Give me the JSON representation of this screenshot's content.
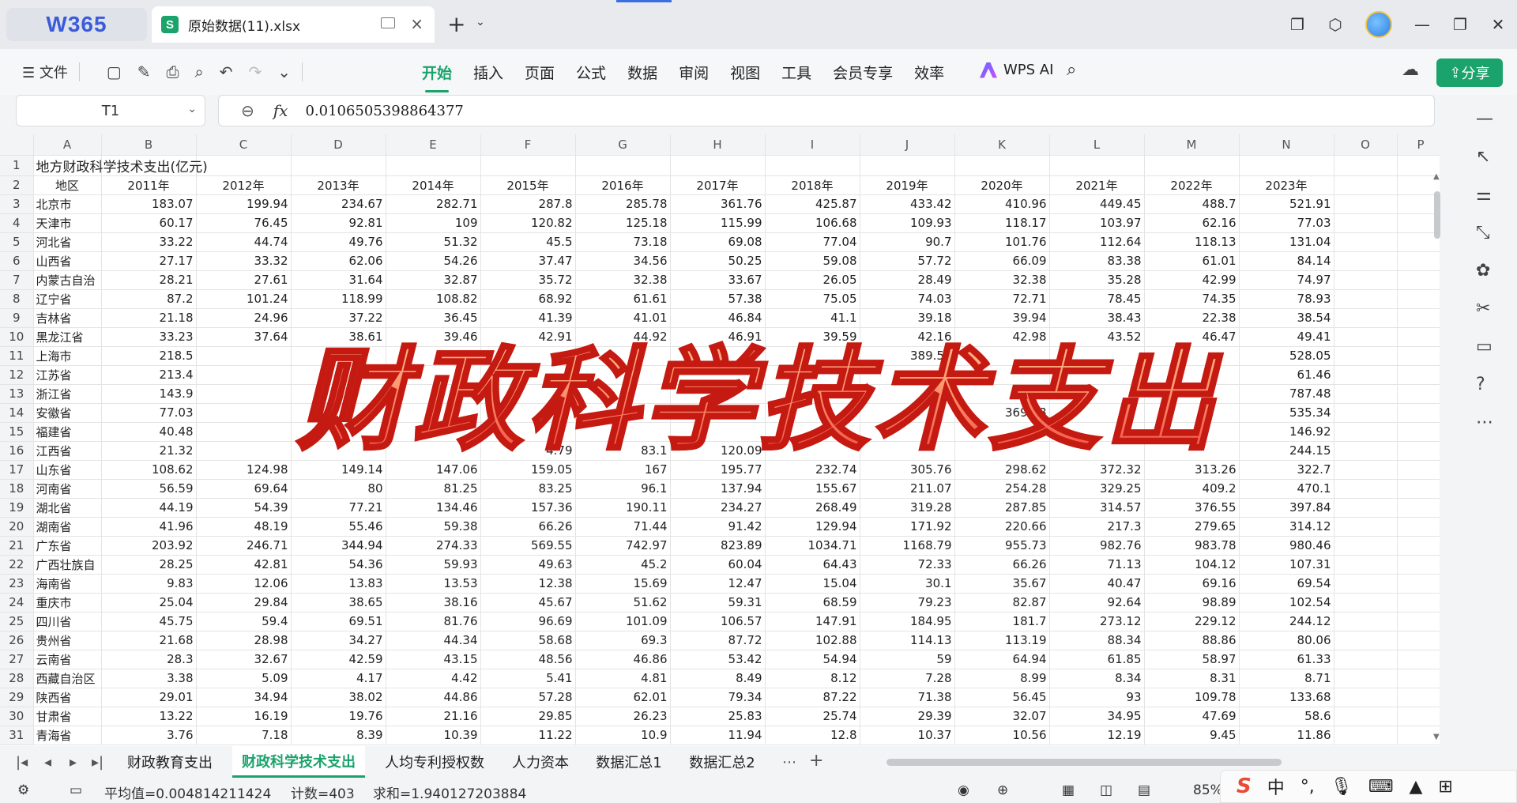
{
  "app": {
    "logo": "W365",
    "doc_tab": "原始数据(11).xlsx",
    "doc_icon": "S"
  },
  "toolbar": {
    "menu": "文件",
    "tabs": [
      "开始",
      "插入",
      "页面",
      "公式",
      "数据",
      "审阅",
      "视图",
      "工具",
      "会员专享",
      "效率"
    ],
    "active_tab": "开始",
    "wps_ai": "WPS AI",
    "share": "分享"
  },
  "formula_bar": {
    "name_box": "T1",
    "fx": "fx",
    "value": "0.0106505398864377"
  },
  "grid": {
    "columns": [
      "A",
      "B",
      "C",
      "D",
      "E",
      "F",
      "G",
      "H",
      "I",
      "J",
      "K",
      "L",
      "M",
      "N",
      "O",
      "P"
    ],
    "title": "地方财政科学技术支出(亿元)",
    "header": [
      "地区",
      "2011年",
      "2012年",
      "2013年",
      "2014年",
      "2015年",
      "2016年",
      "2017年",
      "2018年",
      "2019年",
      "2020年",
      "2021年",
      "2022年",
      "2023年"
    ],
    "rows": [
      [
        "北京市",
        "183.07",
        "199.94",
        "234.67",
        "282.71",
        "287.8",
        "285.78",
        "361.76",
        "425.87",
        "433.42",
        "410.96",
        "449.45",
        "488.7",
        "521.91"
      ],
      [
        "天津市",
        "60.17",
        "76.45",
        "92.81",
        "109",
        "120.82",
        "125.18",
        "115.99",
        "106.68",
        "109.93",
        "118.17",
        "103.97",
        "62.16",
        "77.03"
      ],
      [
        "河北省",
        "33.22",
        "44.74",
        "49.76",
        "51.32",
        "45.5",
        "73.18",
        "69.08",
        "77.04",
        "90.7",
        "101.76",
        "112.64",
        "118.13",
        "131.04"
      ],
      [
        "山西省",
        "27.17",
        "33.32",
        "62.06",
        "54.26",
        "37.47",
        "34.56",
        "50.25",
        "59.08",
        "57.72",
        "66.09",
        "83.38",
        "61.01",
        "84.14"
      ],
      [
        "内蒙古自治",
        "28.21",
        "27.61",
        "31.64",
        "32.87",
        "35.72",
        "32.38",
        "33.67",
        "26.05",
        "28.49",
        "32.38",
        "35.28",
        "42.99",
        "74.97"
      ],
      [
        "辽宁省",
        "87.2",
        "101.24",
        "118.99",
        "108.82",
        "68.92",
        "61.61",
        "57.38",
        "75.05",
        "74.03",
        "72.71",
        "78.45",
        "74.35",
        "78.93"
      ],
      [
        "吉林省",
        "21.18",
        "24.96",
        "37.22",
        "36.45",
        "41.39",
        "41.01",
        "46.84",
        "41.1",
        "39.18",
        "39.94",
        "38.43",
        "22.38",
        "38.54"
      ],
      [
        "黑龙江省",
        "33.23",
        "37.64",
        "38.61",
        "39.46",
        "42.91",
        "44.92",
        "46.91",
        "39.59",
        "42.16",
        "42.98",
        "43.52",
        "46.47",
        "49.41"
      ],
      [
        "上海市",
        "218.5",
        "",
        "",
        "",
        "",
        "",
        "",
        "",
        "389.54",
        "",
        "",
        "",
        "528.05"
      ],
      [
        "江苏省",
        "213.4",
        "",
        "",
        "",
        "",
        "",
        "",
        "",
        "",
        "",
        "",
        "",
        "61.46"
      ],
      [
        "浙江省",
        "143.9",
        "",
        "",
        "",
        "",
        "",
        "",
        "",
        "",
        "",
        "",
        "",
        "787.48"
      ],
      [
        "安徽省",
        "77.03",
        "",
        "",
        "",
        "",
        "",
        "",
        "",
        "",
        "369.98",
        "",
        "",
        "535.34"
      ],
      [
        "福建省",
        "40.48",
        "",
        "",
        "",
        "",
        "",
        "",
        "",
        "",
        "",
        "",
        "",
        "146.92"
      ],
      [
        "江西省",
        "21.32",
        "",
        "",
        "",
        "4.79",
        "83.1",
        "120.09",
        "",
        "",
        "",
        "",
        "",
        "244.15"
      ],
      [
        "山东省",
        "108.62",
        "124.98",
        "149.14",
        "147.06",
        "159.05",
        "167",
        "195.77",
        "232.74",
        "305.76",
        "298.62",
        "372.32",
        "313.26",
        "322.7"
      ],
      [
        "河南省",
        "56.59",
        "69.64",
        "80",
        "81.25",
        "83.25",
        "96.1",
        "137.94",
        "155.67",
        "211.07",
        "254.28",
        "329.25",
        "409.2",
        "470.1"
      ],
      [
        "湖北省",
        "44.19",
        "54.39",
        "77.21",
        "134.46",
        "157.36",
        "190.11",
        "234.27",
        "268.49",
        "319.28",
        "287.85",
        "314.57",
        "376.55",
        "397.84"
      ],
      [
        "湖南省",
        "41.96",
        "48.19",
        "55.46",
        "59.38",
        "66.26",
        "71.44",
        "91.42",
        "129.94",
        "171.92",
        "220.66",
        "217.3",
        "279.65",
        "314.12"
      ],
      [
        "广东省",
        "203.92",
        "246.71",
        "344.94",
        "274.33",
        "569.55",
        "742.97",
        "823.89",
        "1034.71",
        "1168.79",
        "955.73",
        "982.76",
        "983.78",
        "980.46"
      ],
      [
        "广西壮族自",
        "28.25",
        "42.81",
        "54.36",
        "59.93",
        "49.63",
        "45.2",
        "60.04",
        "64.43",
        "72.33",
        "66.26",
        "71.13",
        "104.12",
        "107.31"
      ],
      [
        "海南省",
        "9.83",
        "12.06",
        "13.83",
        "13.53",
        "12.38",
        "15.69",
        "12.47",
        "15.04",
        "30.1",
        "35.67",
        "40.47",
        "69.16",
        "69.54"
      ],
      [
        "重庆市",
        "25.04",
        "29.84",
        "38.65",
        "38.16",
        "45.67",
        "51.62",
        "59.31",
        "68.59",
        "79.23",
        "82.87",
        "92.64",
        "98.89",
        "102.54"
      ],
      [
        "四川省",
        "45.75",
        "59.4",
        "69.51",
        "81.76",
        "96.69",
        "101.09",
        "106.57",
        "147.91",
        "184.95",
        "181.7",
        "273.12",
        "229.12",
        "244.12"
      ],
      [
        "贵州省",
        "21.68",
        "28.98",
        "34.27",
        "44.34",
        "58.68",
        "69.3",
        "87.72",
        "102.88",
        "114.13",
        "113.19",
        "88.34",
        "88.86",
        "80.06"
      ],
      [
        "云南省",
        "28.3",
        "32.67",
        "42.59",
        "43.15",
        "48.56",
        "46.86",
        "53.42",
        "54.94",
        "59",
        "64.94",
        "61.85",
        "58.97",
        "61.33"
      ],
      [
        "西藏自治区",
        "3.38",
        "5.09",
        "4.17",
        "4.42",
        "5.41",
        "4.81",
        "8.49",
        "8.12",
        "7.28",
        "8.99",
        "8.34",
        "8.31",
        "8.71"
      ],
      [
        "陕西省",
        "29.01",
        "34.94",
        "38.02",
        "44.86",
        "57.28",
        "62.01",
        "79.34",
        "87.22",
        "71.38",
        "56.45",
        "93",
        "109.78",
        "133.68"
      ],
      [
        "甘肃省",
        "13.22",
        "16.19",
        "19.76",
        "21.16",
        "29.85",
        "26.23",
        "25.83",
        "25.74",
        "29.39",
        "32.07",
        "34.95",
        "47.69",
        "58.6"
      ],
      [
        "青海省",
        "3.76",
        "7.18",
        "8.39",
        "10.39",
        "11.22",
        "10.9",
        "11.94",
        "12.8",
        "10.37",
        "10.56",
        "12.19",
        "9.45",
        "11.86"
      ]
    ]
  },
  "overlay_title": "财政科学技术支出",
  "sheets": {
    "tabs": [
      "财政教育支出",
      "财政科学技术支出",
      "人均专利授权数",
      "人力资本",
      "数据汇总1",
      "数据汇总2"
    ],
    "active": "财政科学技术支出"
  },
  "status": {
    "average": "平均值=0.004814211424",
    "count": "计数=403",
    "sum": "求和=1.940127203884",
    "zoom": "85%"
  },
  "ime": {
    "lang": "中"
  }
}
